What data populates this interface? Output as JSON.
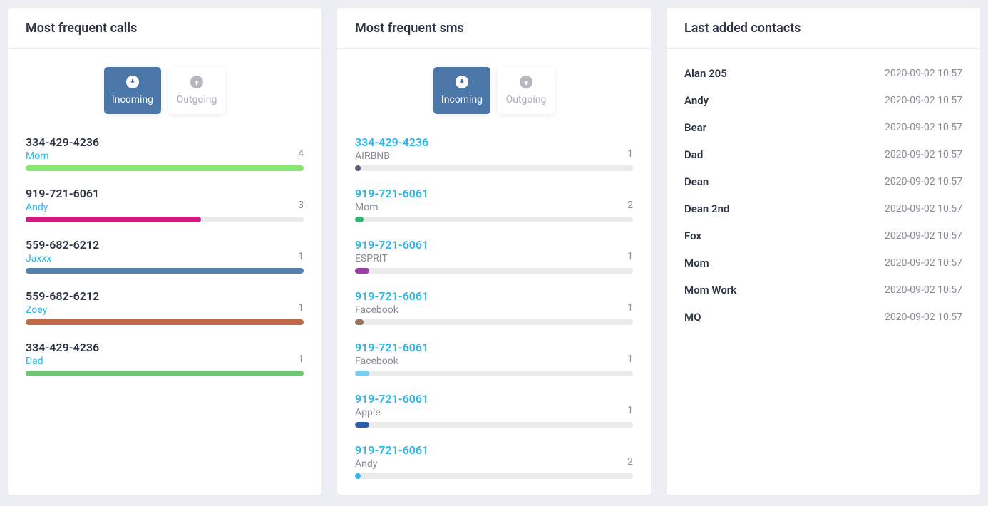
{
  "calls": {
    "title": "Most frequent calls",
    "tabs": {
      "incoming": "Incoming",
      "outgoing": "Outgoing"
    },
    "items": [
      {
        "phone": "334-429-4236",
        "name": "Mom",
        "count": "4",
        "phoneLink": false,
        "nameLink": true,
        "barPct": 100,
        "barColor": "#87e66d"
      },
      {
        "phone": "919-721-6061",
        "name": "Andy",
        "count": "3",
        "phoneLink": false,
        "nameLink": true,
        "barPct": 63,
        "barColor": "#d11a7e"
      },
      {
        "phone": "559-682-6212",
        "name": "Jaxxx",
        "count": "1",
        "phoneLink": false,
        "nameLink": true,
        "barPct": 100,
        "barColor": "#5681a9"
      },
      {
        "phone": "559-682-6212",
        "name": "Zoey",
        "count": "1",
        "phoneLink": false,
        "nameLink": true,
        "barPct": 100,
        "barColor": "#bd6847"
      },
      {
        "phone": "334-429-4236",
        "name": "Dad",
        "count": "1",
        "phoneLink": false,
        "nameLink": true,
        "barPct": 100,
        "barColor": "#70c577"
      }
    ]
  },
  "sms": {
    "title": "Most frequent sms",
    "tabs": {
      "incoming": "Incoming",
      "outgoing": "Outgoing"
    },
    "items": [
      {
        "phone": "334-429-4236",
        "name": "AIRBNB",
        "count": "1",
        "phoneLink": true,
        "nameLink": false,
        "barPct": 2,
        "barColor": "#5b5d72"
      },
      {
        "phone": "919-721-6061",
        "name": "Mom",
        "count": "2",
        "phoneLink": true,
        "nameLink": false,
        "barPct": 3,
        "barColor": "#2fb66f"
      },
      {
        "phone": "919-721-6061",
        "name": "ESPRIT",
        "count": "1",
        "phoneLink": true,
        "nameLink": false,
        "barPct": 5,
        "barColor": "#9a3fa6"
      },
      {
        "phone": "919-721-6061",
        "name": "Facebook",
        "count": "1",
        "phoneLink": true,
        "nameLink": false,
        "barPct": 3,
        "barColor": "#9a745f"
      },
      {
        "phone": "919-721-6061",
        "name": "Facebook",
        "count": "1",
        "phoneLink": true,
        "nameLink": false,
        "barPct": 5,
        "barColor": "#79cdf3"
      },
      {
        "phone": "919-721-6061",
        "name": "Apple",
        "count": "1",
        "phoneLink": true,
        "nameLink": false,
        "barPct": 5,
        "barColor": "#2d5da9"
      },
      {
        "phone": "919-721-6061",
        "name": "Andy",
        "count": "2",
        "phoneLink": true,
        "nameLink": false,
        "barPct": 2,
        "barColor": "#2fb6e8"
      }
    ]
  },
  "contacts": {
    "title": "Last added contacts",
    "items": [
      {
        "name": "Alan 205",
        "date": "2020-09-02 10:57"
      },
      {
        "name": "Andy",
        "date": "2020-09-02 10:57"
      },
      {
        "name": "Bear",
        "date": "2020-09-02 10:57"
      },
      {
        "name": "Dad",
        "date": "2020-09-02 10:57"
      },
      {
        "name": "Dean",
        "date": "2020-09-02 10:57"
      },
      {
        "name": "Dean 2nd",
        "date": "2020-09-02 10:57"
      },
      {
        "name": "Fox",
        "date": "2020-09-02 10:57"
      },
      {
        "name": "Mom",
        "date": "2020-09-02 10:57"
      },
      {
        "name": "Mom Work",
        "date": "2020-09-02 10:57"
      },
      {
        "name": "MQ",
        "date": "2020-09-02 10:57"
      }
    ]
  }
}
